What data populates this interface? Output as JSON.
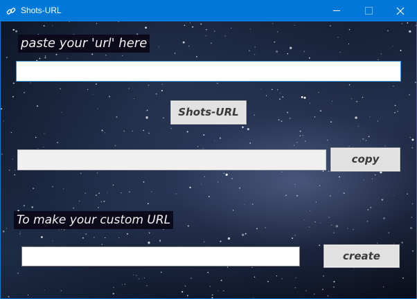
{
  "window": {
    "title": "Shots-URL",
    "icon": "link-icon",
    "controls": {
      "minimize": "minimize-icon",
      "maximize": "maximize-icon",
      "close": "close-icon"
    }
  },
  "main": {
    "paste_label": "paste your 'url' here",
    "url_input_value": "",
    "shorten_button": "Shots-URL",
    "result_value": "",
    "copy_button": "copy",
    "custom_label": "To make your custom URL",
    "custom_input_value": "",
    "create_button": "create"
  },
  "colors": {
    "titlebar": "#0078d7",
    "label_background": "#0a0a1a",
    "button_background": "#e1e1e1"
  }
}
